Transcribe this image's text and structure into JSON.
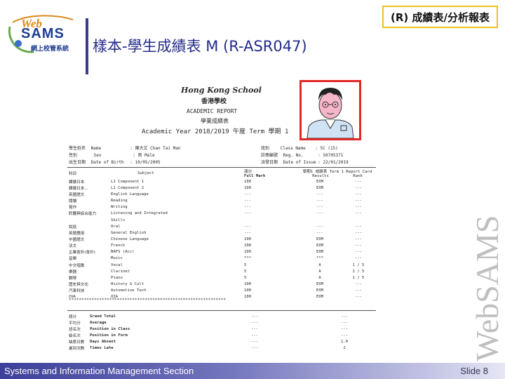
{
  "header": {
    "logo_web": "Web",
    "logo_sams": "SAMS",
    "logo_sub": "網上校管系統",
    "section_tag": "(R) 成績表/分析報表",
    "slide_title": "樣本-學生成績表 M (R-ASR047)"
  },
  "report": {
    "school_en": "Hong Kong School",
    "school_cn": "香港學校",
    "report_en": "ACADEMIC REPORT",
    "report_cn": "學業成績表",
    "year_line": "Academic Year 2018/2019 午度 Term 學期 1",
    "info_left": [
      {
        "cn": "學生姓名",
        "en": "Name",
        "value": ":  陳大文 Chan Tai Man"
      },
      {
        "cn": "性別",
        "en": "Sex",
        "value": ":  男     Male"
      },
      {
        "cn": "出生日期",
        "en": "Date of Birth",
        "value": ":  10/05/2005"
      }
    ],
    "info_right": [
      {
        "cn": "班別",
        "en": "Class Name",
        "value": ":  5C (15)"
      },
      {
        "cn": "註冊編號",
        "en": "Reg. No.",
        "value": ":  S0705371"
      },
      {
        "cn": "派發日期",
        "en": "Date of Issue",
        "value": ":  22/01/2019"
      }
    ],
    "table_head": {
      "subject_cn": "科目",
      "subject_en": "Subject",
      "fullmark_cn": "滿分",
      "fullmark_en": "Full Mark",
      "term_head": "學期1 成績表 Term 1 Report Card",
      "col_g1": "Results",
      "col_g2": "Rank"
    },
    "rows": [
      {
        "cn": "課擴日本",
        "en": "L1 Component 1",
        "fm": "100",
        "g1": "EXM",
        "g2": "---"
      },
      {
        "cn": "課擴日本...",
        "en": "L1 Component 2",
        "fm": "100",
        "g1": "EXM",
        "g2": "---"
      },
      {
        "cn": "英國語文",
        "en": "English Language",
        "fm": "---",
        "g1": "---",
        "g2": "---"
      },
      {
        "cn": "閱讀",
        "en": "Reading",
        "fm": "---",
        "g1": "---",
        "g2": "---"
      },
      {
        "cn": "寫作",
        "en": "Writing",
        "fm": "---",
        "g1": "---",
        "g2": "---"
      },
      {
        "cn": "聆聽與綜合能力",
        "en": "Listening and Integrated",
        "fm": "---",
        "g1": "---",
        "g2": "---"
      },
      {
        "cn": "",
        "en": "Skills",
        "fm": "",
        "g1": "",
        "g2": ""
      },
      {
        "cn": "說話",
        "en": "Oral",
        "fm": "---",
        "g1": "---",
        "g2": "---"
      },
      {
        "cn": "英語應用",
        "en": "General English",
        "fm": "---",
        "g1": "---",
        "g2": "---"
      },
      {
        "cn": "中國語文",
        "en": "Chinese Language",
        "fm": "100",
        "g1": "EXM",
        "g2": "---"
      },
      {
        "cn": "法文",
        "en": "French",
        "fm": "100",
        "g1": "EXM",
        "g2": "---"
      },
      {
        "cn": "企業會計(會計)",
        "en": "BAFS (Acc)",
        "fm": "100",
        "g1": "EXM",
        "g2": "---"
      },
      {
        "cn": "音樂",
        "en": "Music",
        "fm": "***",
        "g1": "***",
        "g2": "---"
      },
      {
        "cn": "中文唱歌",
        "en": "Vocal",
        "fm": "5",
        "g1": "A",
        "g2": "1 / 5"
      },
      {
        "cn": "樂器",
        "en": "Clarinet",
        "fm": "5",
        "g1": "A",
        "g2": "1 / 5"
      },
      {
        "cn": "鋼琴",
        "en": "Piano",
        "fm": "5",
        "g1": "A",
        "g2": "1 / 5"
      },
      {
        "cn": "歷史與文化",
        "en": "History & Cult",
        "fm": "100",
        "g1": "EXM",
        "g2": "---"
      },
      {
        "cn": "汽車科技",
        "en": "Automotive Tech",
        "fm": "100",
        "g1": "EXM",
        "g2": "---"
      },
      {
        "cn": "OIA",
        "en": "OIA",
        "fm": "100",
        "g1": "EXM",
        "g2": "---"
      }
    ],
    "summary": [
      {
        "cn": "總分",
        "en": "Grand Total",
        "v1": "---",
        "v2": "---"
      },
      {
        "cn": "平均分",
        "en": "Average",
        "v1": "---",
        "v2": "---"
      },
      {
        "cn": "班名次",
        "en": "Position in Class",
        "v1": "---",
        "v2": "---"
      },
      {
        "cn": "級名次",
        "en": "Position in Form",
        "v1": "---",
        "v2": "---"
      },
      {
        "cn": "缺席日數",
        "en": "Days Absent",
        "v1": "---",
        "v2": "1.0"
      },
      {
        "cn": "遲到次數",
        "en": "Times Late",
        "v1": "---",
        "v2": "2"
      }
    ]
  },
  "watermark": "WebSAMS",
  "footer": {
    "left": "Systems and Information Management Section",
    "right": "Slide 8"
  },
  "colors": {
    "title": "#242c88",
    "tag_border": "#f0c020",
    "photo_border": "#e02828",
    "footer_start": "#3d3f9a"
  }
}
